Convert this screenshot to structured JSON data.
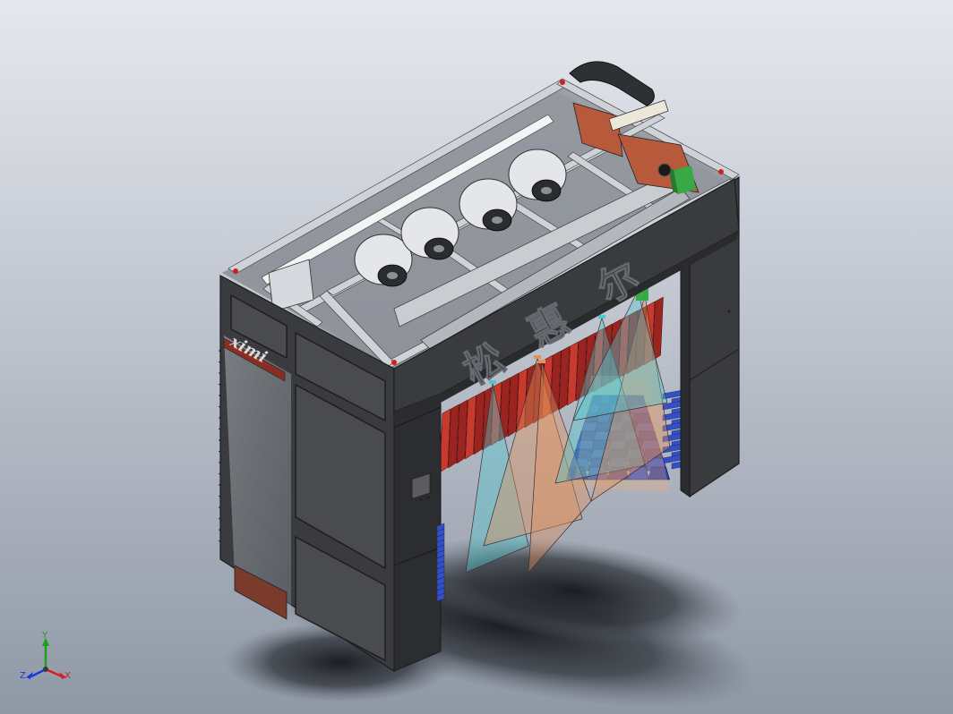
{
  "viewport": {
    "background_top": "#e6e8ee",
    "background_bottom": "#8f98a6",
    "shadow_color": "#1a1c22"
  },
  "model": {
    "frame_color": "#3a3b3e",
    "panel_color": "#4a4b4f",
    "panel_edge": "#1c1c1e",
    "rail_color": "#cfd3d8",
    "brush_red": "#b22a24",
    "brush_blue": "#3450c8",
    "brand_chars": [
      "松",
      "惠",
      "尔"
    ],
    "side_logo": "ximi",
    "spray_cyan": "#4fc7d0",
    "spray_orange": "#e3905a",
    "motor_green": "#3aa845"
  },
  "triad": {
    "x_label": "X",
    "y_label": "Y",
    "z_label": "Z",
    "x_color": "#d62020",
    "y_color": "#1aa01a",
    "z_color": "#1a3ad8"
  }
}
